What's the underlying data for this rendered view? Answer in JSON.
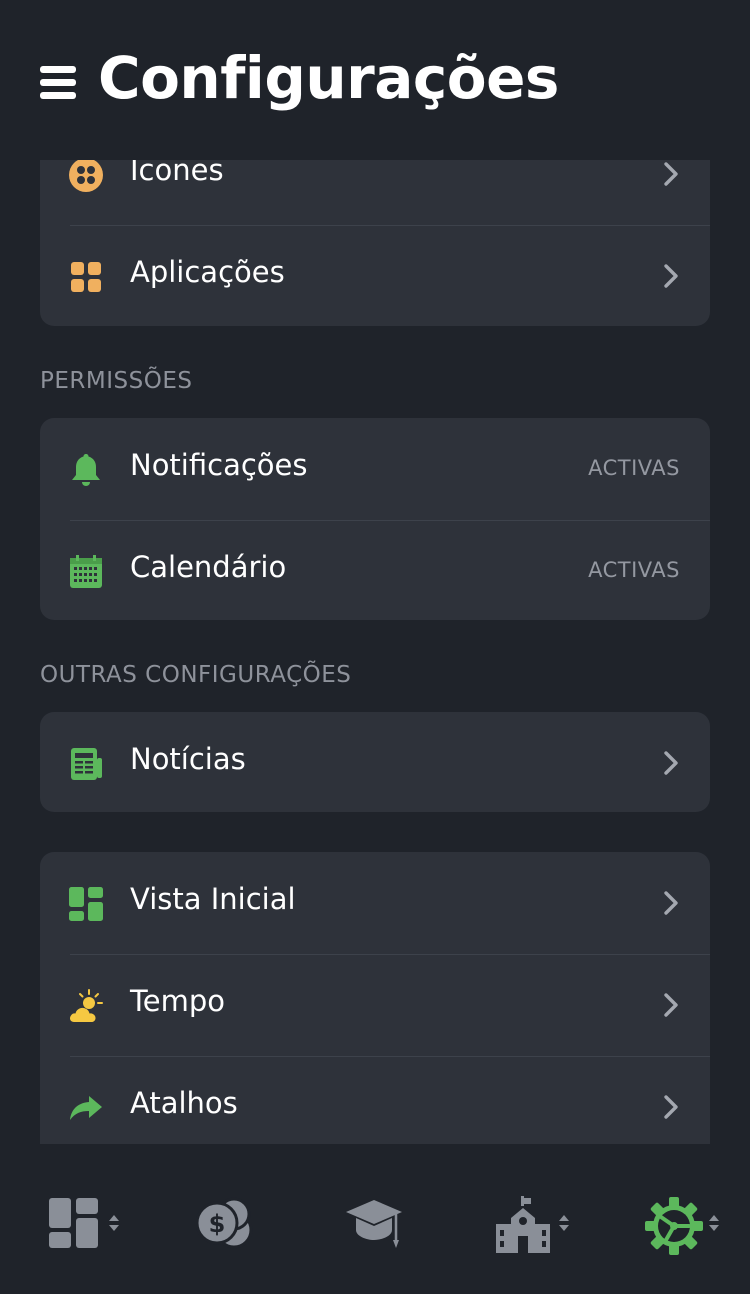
{
  "header": {
    "title": "Configurações"
  },
  "card_appearance": {
    "items": [
      {
        "label": "Ícones",
        "icon": "icons-icon",
        "color": "#f0b05f"
      },
      {
        "label": "Aplicações",
        "icon": "apps-grid-icon",
        "color": "#f0b05f"
      }
    ]
  },
  "permissions": {
    "section_title": "PERMISSÕES",
    "items": [
      {
        "label": "Notificações",
        "value": "ACTIVAS",
        "icon": "bell-icon",
        "color": "#5cb85c"
      },
      {
        "label": "Calendário",
        "value": "ACTIVAS",
        "icon": "calendar-icon",
        "color": "#5cb85c"
      }
    ]
  },
  "other": {
    "section_title": "OUTRAS CONFIGURAÇÕES",
    "items": [
      {
        "label": "Notícias",
        "icon": "newspaper-icon",
        "color": "#5cb85c"
      }
    ]
  },
  "home": {
    "items": [
      {
        "label": "Vista Inicial",
        "icon": "dashboard-icon",
        "color": "#5cb85c"
      },
      {
        "label": "Tempo",
        "icon": "weather-icon",
        "color": "#f5c842"
      },
      {
        "label": "Atalhos",
        "icon": "share-arrow-icon",
        "color": "#5cb85c"
      }
    ]
  },
  "tabbar": {
    "tabs": [
      {
        "name": "dashboard",
        "icon": "dashboard-icon",
        "active": false
      },
      {
        "name": "finance",
        "icon": "coins-icon",
        "active": false
      },
      {
        "name": "academic",
        "icon": "graduation-cap-icon",
        "active": false
      },
      {
        "name": "school",
        "icon": "school-building-icon",
        "active": false
      },
      {
        "name": "settings",
        "icon": "gear-icon",
        "active": true
      }
    ],
    "active_color": "#5cb85c",
    "inactive_color": "#8a8f98"
  }
}
